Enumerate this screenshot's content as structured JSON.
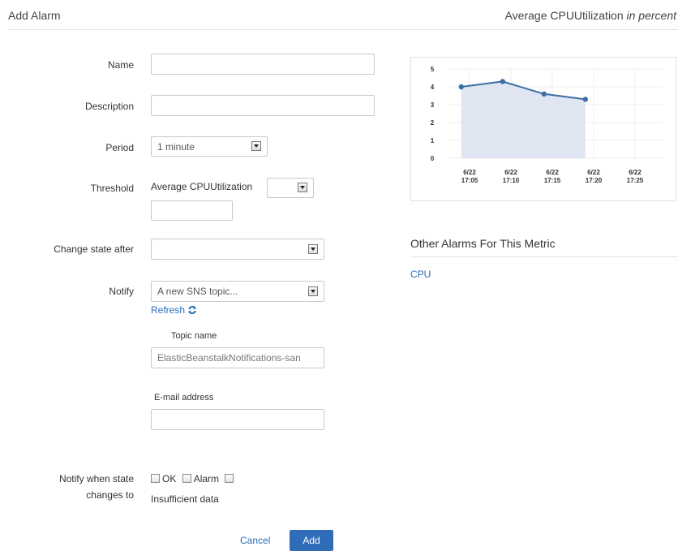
{
  "header": {
    "title": "Add Alarm",
    "metric_name": "Average CPUUtilization",
    "metric_unit": "in percent"
  },
  "form": {
    "name_label": "Name",
    "name_value": "",
    "description_label": "Description",
    "description_value": "",
    "period_label": "Period",
    "period_value": "1 minute",
    "threshold_label": "Threshold",
    "threshold_metric": "Average CPUUtilization",
    "threshold_operator": "",
    "threshold_value": "",
    "change_state_label": "Change state after",
    "change_state_value": "",
    "notify_label": "Notify",
    "notify_value": "A new SNS topic...",
    "refresh_label": "Refresh",
    "topic_name_label": "Topic name",
    "topic_name_value": "ElasticBeanstalkNotifications-san",
    "email_label": "E-mail address",
    "email_value": "",
    "notify_state_label_line1": "Notify when state",
    "notify_state_label_line2": "changes to",
    "state_options": [
      {
        "label": "OK",
        "checked": false
      },
      {
        "label": "Alarm",
        "checked": false
      },
      {
        "label": "Insufficient data",
        "checked": false
      }
    ]
  },
  "actions": {
    "cancel_label": "Cancel",
    "add_label": "Add"
  },
  "sidebar": {
    "other_alarms_title": "Other Alarms For This Metric",
    "alarms": [
      "CPU"
    ]
  },
  "colors": {
    "accent": "#2f6db9",
    "link": "#2a6ebb",
    "series_line": "#3c6ea6",
    "series_fill": "#dfe6f1"
  },
  "chart_data": {
    "type": "area",
    "title": "Average CPUUtilization in percent",
    "x": [
      "6/22 17:04",
      "6/22 17:09",
      "6/22 17:14",
      "6/22 17:19"
    ],
    "values": [
      4.0,
      4.3,
      3.6,
      3.3
    ],
    "x_ticks": [
      {
        "date": "6/22",
        "time": "17:05"
      },
      {
        "date": "6/22",
        "time": "17:10"
      },
      {
        "date": "6/22",
        "time": "17:15"
      },
      {
        "date": "6/22",
        "time": "17:20"
      },
      {
        "date": "6/22",
        "time": "17:25"
      }
    ],
    "y_ticks": [
      0,
      1,
      2,
      3,
      4,
      5
    ],
    "ylim": [
      0,
      5
    ],
    "grid": true
  }
}
